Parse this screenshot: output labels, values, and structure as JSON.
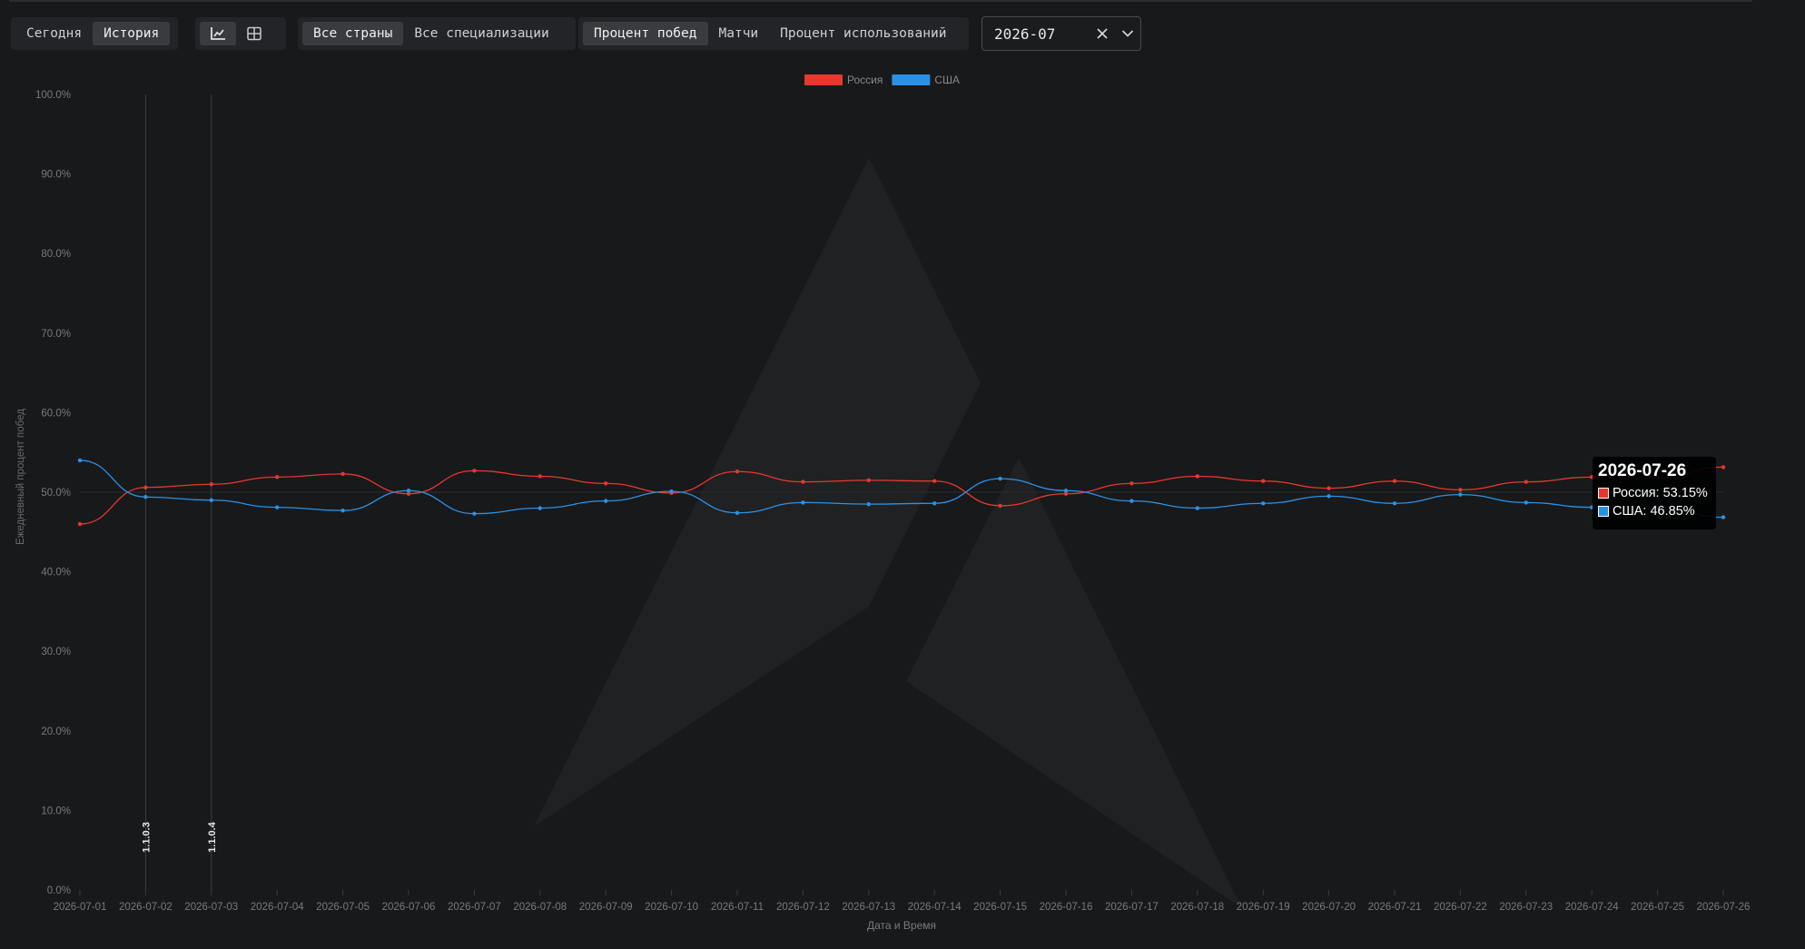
{
  "toolbar": {
    "period_tabs": [
      "Сегодня",
      "История"
    ],
    "view_icons": [
      "line-chart-icon",
      "table-icon"
    ],
    "country_filter": "Все страны",
    "spec_filter": "Все специализации",
    "metric_tabs": [
      "Процент побед",
      "Матчи",
      "Процент использований"
    ],
    "month_select": "2026-07"
  },
  "tooltip": {
    "title": "2026-07-26",
    "rows": [
      {
        "label": "Россия: 53.15%",
        "color": "#e8372f"
      },
      {
        "label": "США: 46.85%",
        "color": "#2a92e6"
      }
    ]
  },
  "colors": {
    "russia": "#e8372f",
    "usa": "#2a92e6",
    "background": "#18191b"
  },
  "chart_data": {
    "type": "line",
    "title": "",
    "xlabel": "Дата и Время",
    "ylabel": "Ежедневный процент побед",
    "ylim": [
      0,
      100
    ],
    "yticks": [
      "0.0%",
      "10.0%",
      "20.0%",
      "30.0%",
      "40.0%",
      "50.0%",
      "60.0%",
      "70.0%",
      "80.0%",
      "90.0%",
      "100.0%"
    ],
    "legend_position": "top-center",
    "grid": false,
    "x": [
      "2026-07-01",
      "2026-07-02",
      "2026-07-03",
      "2026-07-04",
      "2026-07-05",
      "2026-07-06",
      "2026-07-07",
      "2026-07-08",
      "2026-07-09",
      "2026-07-10",
      "2026-07-11",
      "2026-07-12",
      "2026-07-13",
      "2026-07-14",
      "2026-07-15",
      "2026-07-16",
      "2026-07-17",
      "2026-07-18",
      "2026-07-19",
      "2026-07-20",
      "2026-07-21",
      "2026-07-22",
      "2026-07-23",
      "2026-07-24",
      "2026-07-25",
      "2026-07-26"
    ],
    "series": [
      {
        "name": "Россия",
        "color": "#e8372f",
        "values": [
          46.0,
          50.6,
          51.0,
          51.9,
          52.3,
          49.8,
          52.7,
          52.0,
          51.1,
          49.9,
          52.6,
          51.3,
          51.5,
          51.4,
          48.3,
          49.8,
          51.1,
          52.0,
          51.4,
          50.5,
          51.4,
          50.3,
          51.3,
          51.9,
          51.8,
          53.15
        ]
      },
      {
        "name": "США",
        "color": "#2a92e6",
        "values": [
          54.0,
          49.4,
          49.0,
          48.1,
          47.7,
          50.2,
          47.3,
          48.0,
          48.9,
          50.1,
          47.4,
          48.7,
          48.5,
          48.6,
          51.7,
          50.2,
          48.9,
          48.0,
          48.6,
          49.5,
          48.6,
          49.7,
          48.7,
          48.1,
          48.2,
          46.85
        ]
      }
    ],
    "annotations": [
      {
        "x": "2026-07-02",
        "label": "1.1.0.3"
      },
      {
        "x": "2026-07-03",
        "label": "1.1.0.4"
      }
    ]
  }
}
